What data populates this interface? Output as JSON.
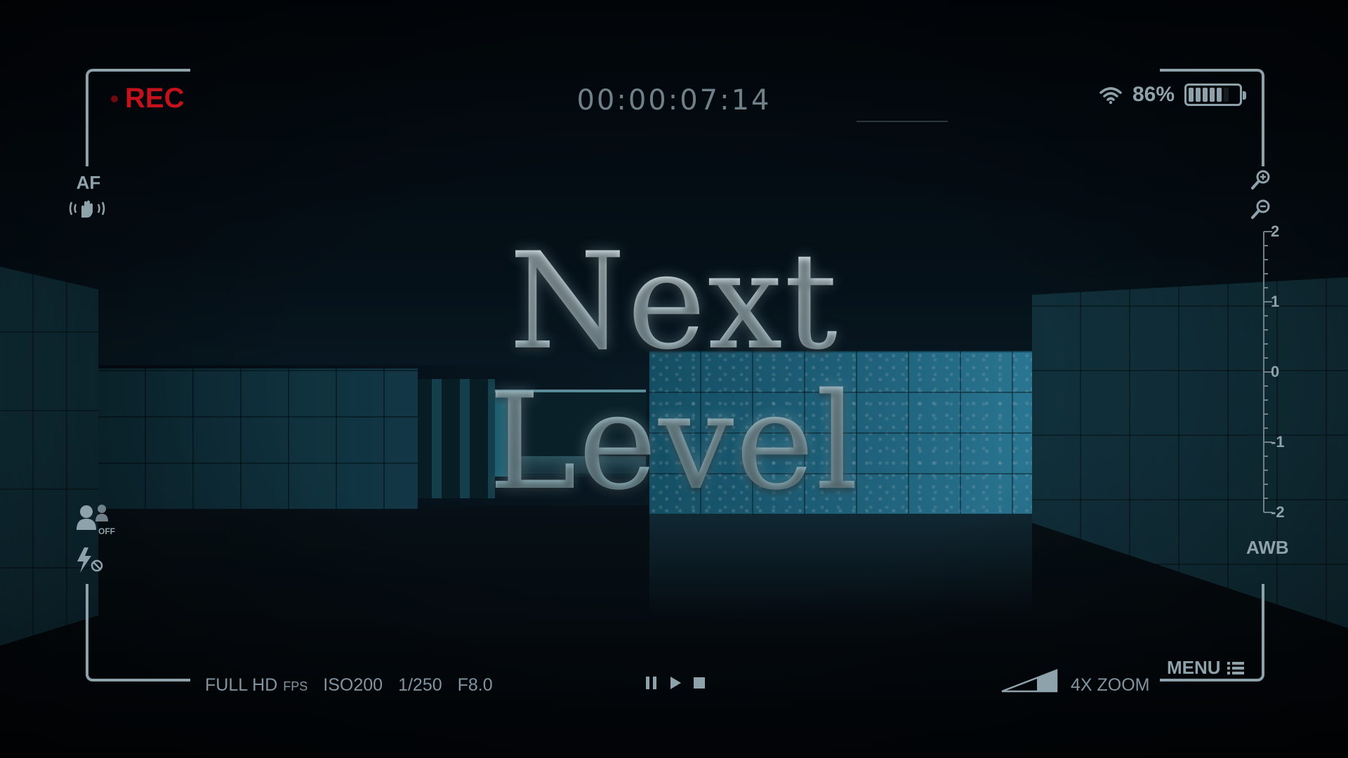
{
  "title": "Next Level",
  "hud": {
    "rec_label": "REC",
    "timecode": "00:00:07:14",
    "battery_percent": "86%",
    "battery_level": 0.86,
    "af_label": "AF",
    "face_detect_label": "OFF",
    "ev_scale": [
      "2",
      "1",
      "0",
      "-1",
      "-2"
    ],
    "awb_label": "AWB",
    "resolution": "FULL HD",
    "fps_label": "FPS",
    "iso": "ISO200",
    "shutter": "1/250",
    "aperture": "F8.0",
    "zoom_level": "4X ZOOM",
    "menu_label": "MENU"
  },
  "icons": {
    "wifi": "wifi-icon",
    "battery": "battery-icon",
    "stabilizer": "hand-stabilizer-icon",
    "zoom_in": "zoom-in-icon",
    "zoom_out": "zoom-out-icon",
    "face": "face-detect-icon",
    "flash": "flash-off-icon",
    "pause": "pause-icon",
    "play": "play-icon",
    "stop": "stop-icon",
    "signal": "signal-strength-icon",
    "menu": "menu-list-icon"
  },
  "colors": {
    "rec": "#c3121c",
    "hud": "#8ea2ab",
    "wall_lit": "#2d86a6"
  }
}
